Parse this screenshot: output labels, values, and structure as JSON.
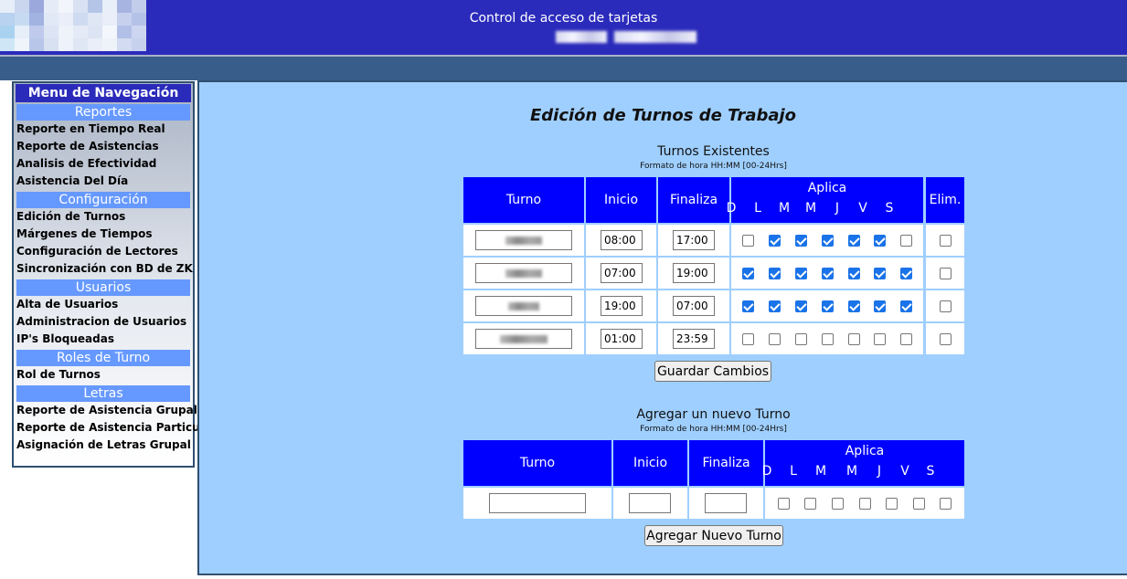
{
  "header": {
    "title": "Control de acceso de tarjetas"
  },
  "colors": {
    "header_bg": "#2b2bbb",
    "band_bg": "#385d8a",
    "main_bg": "#9fcfff",
    "table_header_bg": "#0000ff",
    "nav_section_bg": "#6699ff",
    "checkbox_on": "#1a73e8"
  },
  "nav": {
    "title": "Menu de Navegación",
    "sections": [
      {
        "label": "Reportes",
        "items": [
          "Reporte en Tiempo Real",
          "Reporte de Asistencias",
          "Analisis de Efectividad",
          "Asistencia Del Día"
        ]
      },
      {
        "label": "Configuración",
        "items": [
          "Edición de Turnos",
          "Márgenes de Tiempos",
          "Configuración de Lectores",
          "Sincronización con BD de ZK"
        ]
      },
      {
        "label": "Usuarios",
        "items": [
          "Alta de Usuarios",
          "Administracion de Usuarios",
          "IP's Bloqueadas"
        ]
      },
      {
        "label": "Roles de Turno",
        "items": [
          "Rol de Turnos"
        ]
      },
      {
        "label": "Letras",
        "items": [
          "Reporte de Asistencia Grupal",
          "Reporte de Asistencia Particular",
          "Asignación de Letras Grupal"
        ]
      }
    ]
  },
  "main": {
    "title": "Edición de Turnos de Trabajo",
    "existing": {
      "title": "Turnos Existentes",
      "note": "Formato de hora HH:MM [00-24Hrs]",
      "headers": {
        "turno": "Turno",
        "inicio": "Inicio",
        "finaliza": "Finaliza",
        "aplica": "Aplica",
        "elim": "Elim."
      },
      "days": [
        "D",
        "L",
        "M",
        "M",
        "J",
        "V",
        "S"
      ],
      "rows": [
        {
          "inicio": "08:00",
          "finaliza": "17:00",
          "days": [
            false,
            true,
            true,
            true,
            true,
            true,
            false
          ],
          "elim": false
        },
        {
          "inicio": "07:00",
          "finaliza": "19:00",
          "days": [
            true,
            true,
            true,
            true,
            true,
            true,
            true
          ],
          "elim": false
        },
        {
          "inicio": "19:00",
          "finaliza": "07:00",
          "days": [
            true,
            true,
            true,
            true,
            true,
            true,
            true
          ],
          "elim": false
        },
        {
          "inicio": "01:00",
          "finaliza": "23:59",
          "days": [
            false,
            false,
            false,
            false,
            false,
            false,
            false
          ],
          "elim": false
        }
      ],
      "save_button": "Guardar Cambios"
    },
    "new_shift": {
      "title": "Agregar un nuevo Turno",
      "note": "Formato de hora HH:MM [00-24Hrs]",
      "headers": {
        "turno": "Turno",
        "inicio": "Inicio",
        "finaliza": "Finaliza",
        "aplica": "Aplica"
      },
      "days": [
        "D",
        "L",
        "M",
        "M",
        "J",
        "V",
        "S"
      ],
      "values": {
        "turno": "",
        "inicio": "",
        "finaliza": ""
      },
      "add_button": "Agregar Nuevo Turno"
    }
  }
}
